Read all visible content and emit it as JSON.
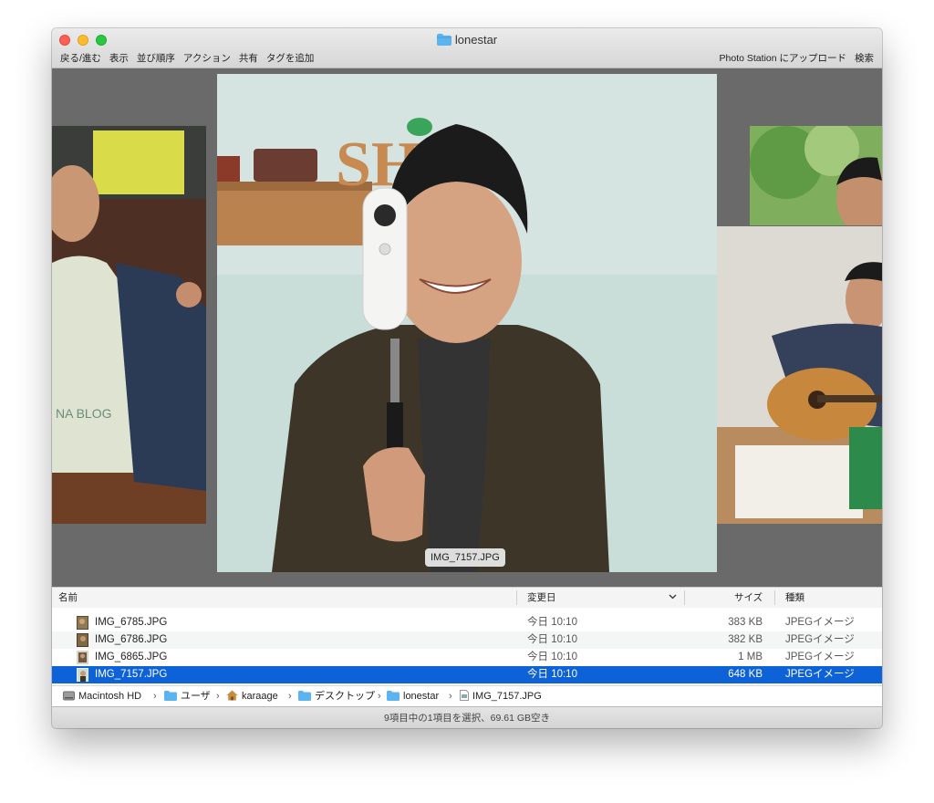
{
  "window": {
    "title": "lonestar"
  },
  "toolbar": {
    "left_items": [
      "戻る/進む",
      "表示",
      "並び順序",
      "アクション",
      "共有",
      "タグを追加"
    ],
    "right_items": [
      "Photo Station にアップロード",
      "検索"
    ]
  },
  "preview": {
    "tooltip": "IMG_7157.JPG",
    "center_photo_text": "SH",
    "left_photo_text": "NA BLOG"
  },
  "list": {
    "columns": [
      "名前",
      "変更日",
      "サイズ",
      "種類"
    ],
    "sort_indicator": "chevron-down-icon",
    "rows": [
      {
        "name": "IMG_6785.JPG",
        "date": "今日 10:10",
        "size": "383 KB",
        "kind": "JPEGイメージ",
        "selected": false
      },
      {
        "name": "IMG_6786.JPG",
        "date": "今日 10:10",
        "size": "382 KB",
        "kind": "JPEGイメージ",
        "selected": false
      },
      {
        "name": "IMG_6865.JPG",
        "date": "今日 10:10",
        "size": "1 MB",
        "kind": "JPEGイメージ",
        "selected": false
      },
      {
        "name": "IMG_7157.JPG",
        "date": "今日 10:10",
        "size": "648 KB",
        "kind": "JPEGイメージ",
        "selected": true
      }
    ]
  },
  "path": [
    "Macintosh HD",
    "ユーザ",
    "karaage",
    "デスクトップ",
    "lonestar",
    "IMG_7157.JPG"
  ],
  "status": "9項目中の1項目を選択、69.61 GB空き",
  "colors": {
    "selection": "#0e62d7",
    "folder": "#5bb3f0",
    "preview_bg": "#6a6a6a"
  }
}
